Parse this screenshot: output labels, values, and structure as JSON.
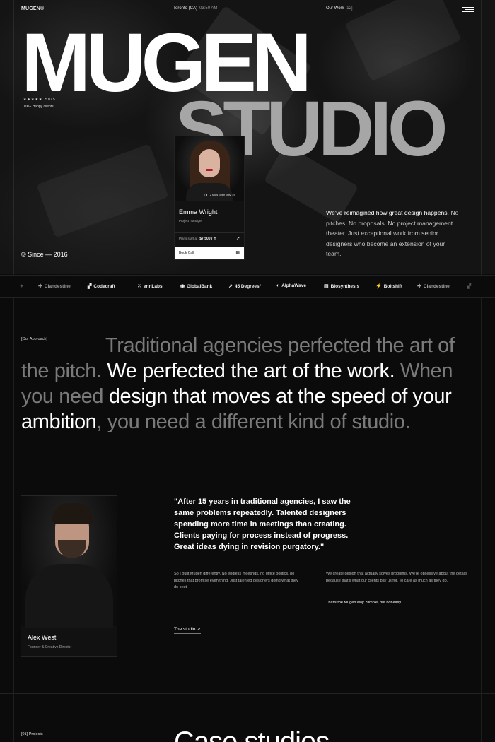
{
  "topbar": {
    "brand": "MUGEN®",
    "location": "Toronto (CA)",
    "time": "03:50 AM",
    "our_work_label": "Our Work",
    "our_work_count": "[12]",
    "menu_icon": "hamburger-icon"
  },
  "hero": {
    "title_line1": "MUGEN",
    "title_line2": "STUDIO",
    "rating_stars": "★★★★★",
    "rating_score": "5.0 / 5",
    "happy_clients": "100+ Happy clients",
    "since": "© Since — 2016",
    "description_bold": "We've reimagined how great design happens.",
    "description_rest": " No pitches. No proposals. No project management theater. Just exceptional work from senior designers who become an extension of your team."
  },
  "contact_card": {
    "slots": "2 slots open",
    "slots_date": "July '25",
    "name": "Emma Wright",
    "role": "Project manager",
    "price_label": "Plans start at",
    "price_value": "$7,500 / m",
    "book_label": "Book Call"
  },
  "logos": [
    {
      "name": "Clandestine",
      "icon": "plus-sparkle-icon"
    },
    {
      "name": "Codecraft_",
      "icon": "blocks-icon"
    },
    {
      "name": "ennLabs",
      "icon": "dots-grid-icon"
    },
    {
      "name": "GlobalBank",
      "icon": "ring-icon"
    },
    {
      "name": "45 Degrees°",
      "icon": "arrow-up-right-icon"
    },
    {
      "name": "AlphaWave",
      "icon": "half-circle-icon"
    },
    {
      "name": "Biosynthesis",
      "icon": "stripes-icon"
    },
    {
      "name": "Boltshift",
      "icon": "bolt-icon"
    },
    {
      "name": "Clandestine",
      "icon": "plus-sparkle-icon"
    }
  ],
  "approach": {
    "label": "[Our Approach]",
    "seg1": "Traditional agencies perfected the art of the pitch. ",
    "seg2": "We perfected the art of the work.",
    "seg3": " When you need ",
    "seg4": "design that moves at the speed of your ambition",
    "seg5": ", you need a different kind of studio."
  },
  "founder": {
    "name": "Alex West",
    "role": "Founder & Creative Director",
    "quote": "\"After 15 years in traditional agencies, I saw the same problems repeatedly. Talented designers spending more time in meetings than creating. Clients paying for process instead of progress. Great ideas dying in revision purgatory.\"",
    "para1": "So I built Mugen differently. No endless meetings, no office politics, no pitches that promise everything. Just talented designers doing what they do best.",
    "para2": "We create design that actually solves problems. We're obsessive about the details because that's what our clients pay us for. To care as much as they do.",
    "tagline": "That's the Mugen way.  Simple, but not easy.",
    "link_label": "The studio",
    "link_icon": "arrow-up-right-icon"
  },
  "projects": {
    "label": "[01] Projects",
    "title": "Case studies"
  }
}
